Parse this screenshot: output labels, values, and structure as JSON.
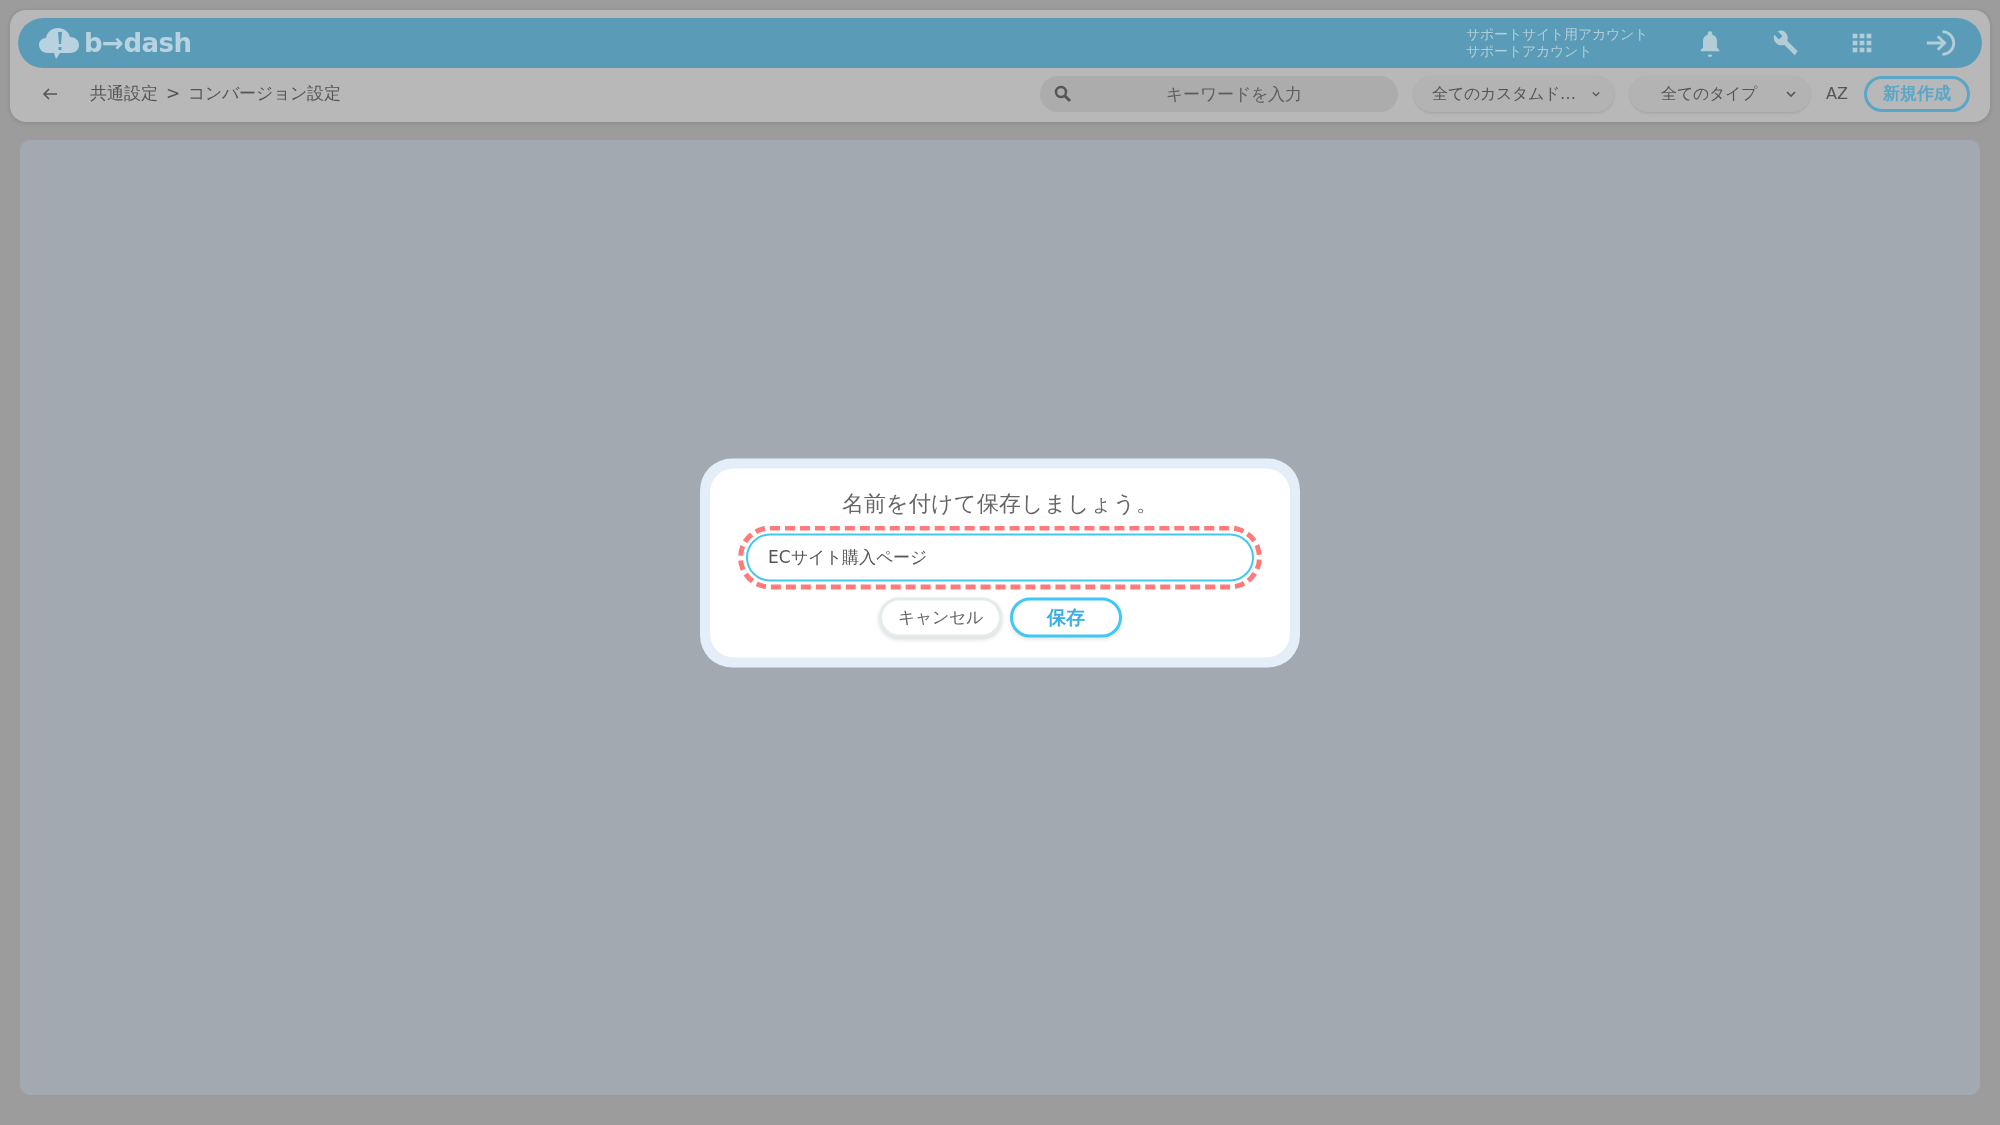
{
  "header": {
    "logo": "b→dash",
    "account_lines": [
      "サポートサイト用アカウント",
      "サポートアカウント"
    ]
  },
  "toolbar": {
    "breadcrumb": [
      "共通設定",
      "コンバージョン設定"
    ],
    "separator": ">",
    "search": {
      "placeholder": "キーワードを入力"
    },
    "filters": [
      "全てのカスタムド…",
      "全てのタイプ"
    ],
    "sort_label": "AZ",
    "new_button": "新規作成"
  },
  "dialog": {
    "title": "名前を付けて保存しましょう。",
    "input": {
      "value": "ECサイト購入ページ",
      "highlighted": true
    },
    "buttons": [
      {
        "label": "キャンセル",
        "kind": "cancel"
      },
      {
        "label": "保存",
        "kind": "primary"
      }
    ]
  }
}
